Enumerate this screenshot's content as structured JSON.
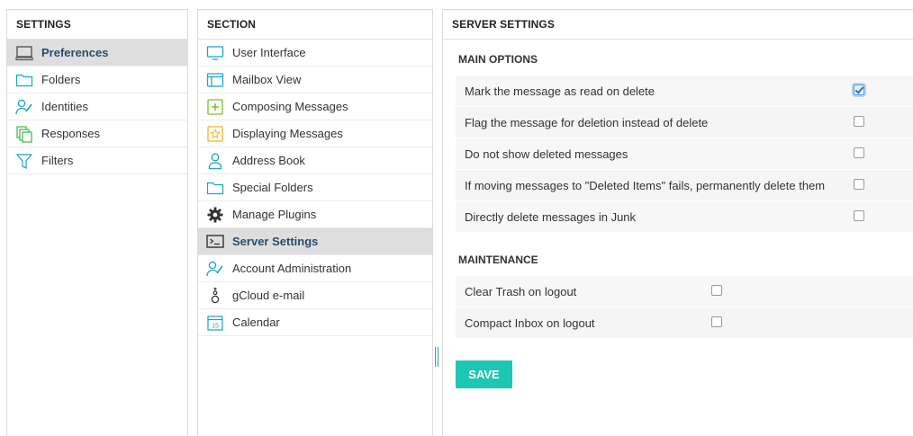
{
  "colors": {
    "accent": "#1ec7b3",
    "icon": "#1aa3c9",
    "selected_text": "#2b4b6b"
  },
  "settings_panel": {
    "title": "SETTINGS",
    "items": [
      {
        "label": "Preferences",
        "icon": "monitor-icon",
        "selected": true
      },
      {
        "label": "Folders",
        "icon": "folder-icon",
        "selected": false
      },
      {
        "label": "Identities",
        "icon": "identity-icon",
        "selected": false
      },
      {
        "label": "Responses",
        "icon": "responses-icon",
        "selected": false
      },
      {
        "label": "Filters",
        "icon": "filter-icon",
        "selected": false
      }
    ]
  },
  "section_panel": {
    "title": "SECTION",
    "items": [
      {
        "label": "User Interface",
        "icon": "monitor-icon",
        "selected": false
      },
      {
        "label": "Mailbox View",
        "icon": "mailbox-icon",
        "selected": false
      },
      {
        "label": "Composing Messages",
        "icon": "compose-icon",
        "selected": false
      },
      {
        "label": "Displaying Messages",
        "icon": "star-icon",
        "selected": false
      },
      {
        "label": "Address Book",
        "icon": "person-icon",
        "selected": false
      },
      {
        "label": "Special Folders",
        "icon": "folder-icon",
        "selected": false
      },
      {
        "label": "Manage Plugins",
        "icon": "gear-icon",
        "selected": false
      },
      {
        "label": "Server Settings",
        "icon": "terminal-icon",
        "selected": true
      },
      {
        "label": "Account Administration",
        "icon": "identity-icon",
        "selected": false
      },
      {
        "label": "gCloud e-mail",
        "icon": "gcloud-icon",
        "selected": false
      },
      {
        "label": "Calendar",
        "icon": "calendar-icon",
        "selected": false
      }
    ]
  },
  "server_panel": {
    "title": "SERVER SETTINGS",
    "main_options": {
      "title": "MAIN OPTIONS",
      "options": [
        {
          "label": "Mark the message as read on delete",
          "checked": true
        },
        {
          "label": "Flag the message for deletion instead of delete",
          "checked": false
        },
        {
          "label": "Do not show deleted messages",
          "checked": false
        },
        {
          "label": "If moving messages to \"Deleted Items\" fails, permanently delete them",
          "checked": false
        },
        {
          "label": "Directly delete messages in Junk",
          "checked": false
        }
      ]
    },
    "maintenance": {
      "title": "MAINTENANCE",
      "options": [
        {
          "label": "Clear Trash on logout",
          "checked": false
        },
        {
          "label": "Compact Inbox on logout",
          "checked": false
        }
      ]
    },
    "save_label": "SAVE",
    "calendar_icon_number": "15"
  }
}
